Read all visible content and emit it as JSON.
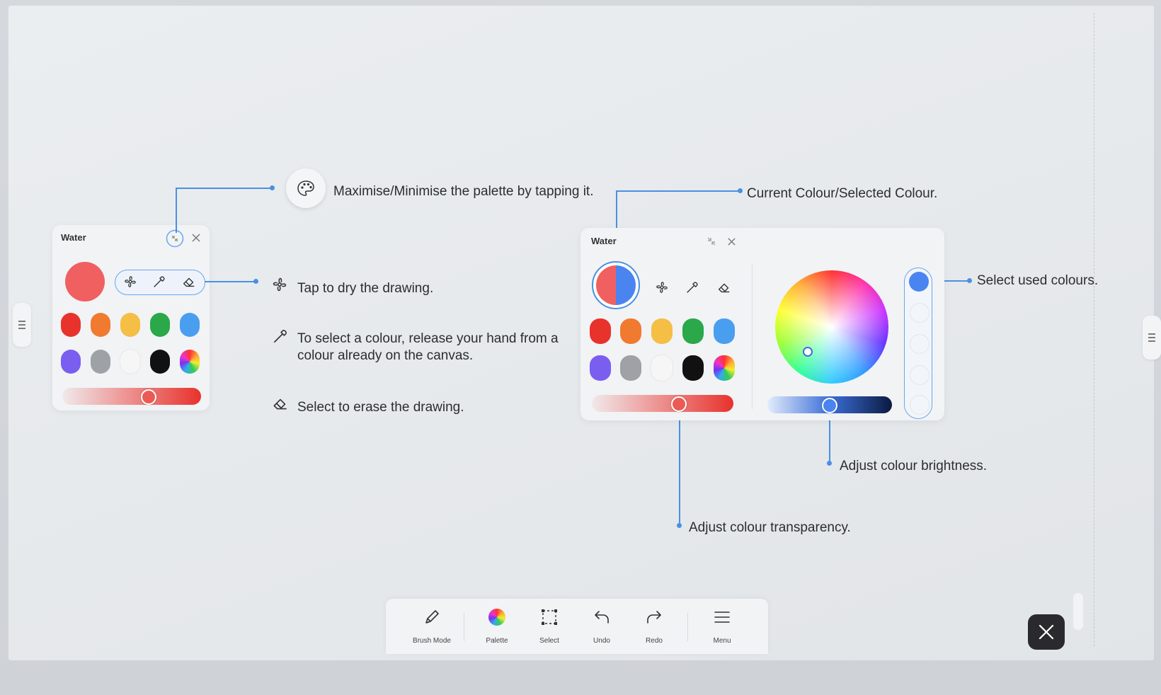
{
  "palette_small": {
    "title": "Water",
    "current_color": "#f06060",
    "swatches": [
      "#e8322c",
      "#f07a30",
      "#f5be45",
      "#2aa84a",
      "#4a9ef0",
      "#7a5ef0",
      "#9ea2a6",
      "#f6f6f6",
      "#111111",
      "rainbow"
    ],
    "transparency_pct": 61
  },
  "palette_large": {
    "title": "Water",
    "current_color": "#f06060",
    "selected_color": "#4a84f0",
    "swatches": [
      "#e8322c",
      "#f07a30",
      "#f5be45",
      "#2aa84a",
      "#4a9ef0",
      "#7a5ef0",
      "#9ea2a6",
      "#f6f6f6",
      "#111111",
      "rainbow"
    ],
    "transparency_pct": 61,
    "brightness_pct": 45,
    "used_colors": [
      "#4a84f0"
    ]
  },
  "annotations": {
    "maximise": "Maximise/Minimise the palette by tapping it.",
    "dry": "Tap to dry the drawing.",
    "select_line1": "To select a colour, release your hand from a",
    "select_line2": "colour already on the canvas.",
    "erase": "Select to erase the drawing.",
    "current": "Current Colour/Selected Colour.",
    "used": "Select used colours.",
    "brightness": "Adjust colour brightness.",
    "transparency": "Adjust colour transparency."
  },
  "toolbar": {
    "brush_mode": "Brush Mode",
    "palette": "Palette",
    "select": "Select",
    "undo": "Undo",
    "redo": "Redo",
    "menu": "Menu"
  },
  "colors": {
    "accent": "#4a90e2",
    "close_button": "#2a2a2c"
  }
}
